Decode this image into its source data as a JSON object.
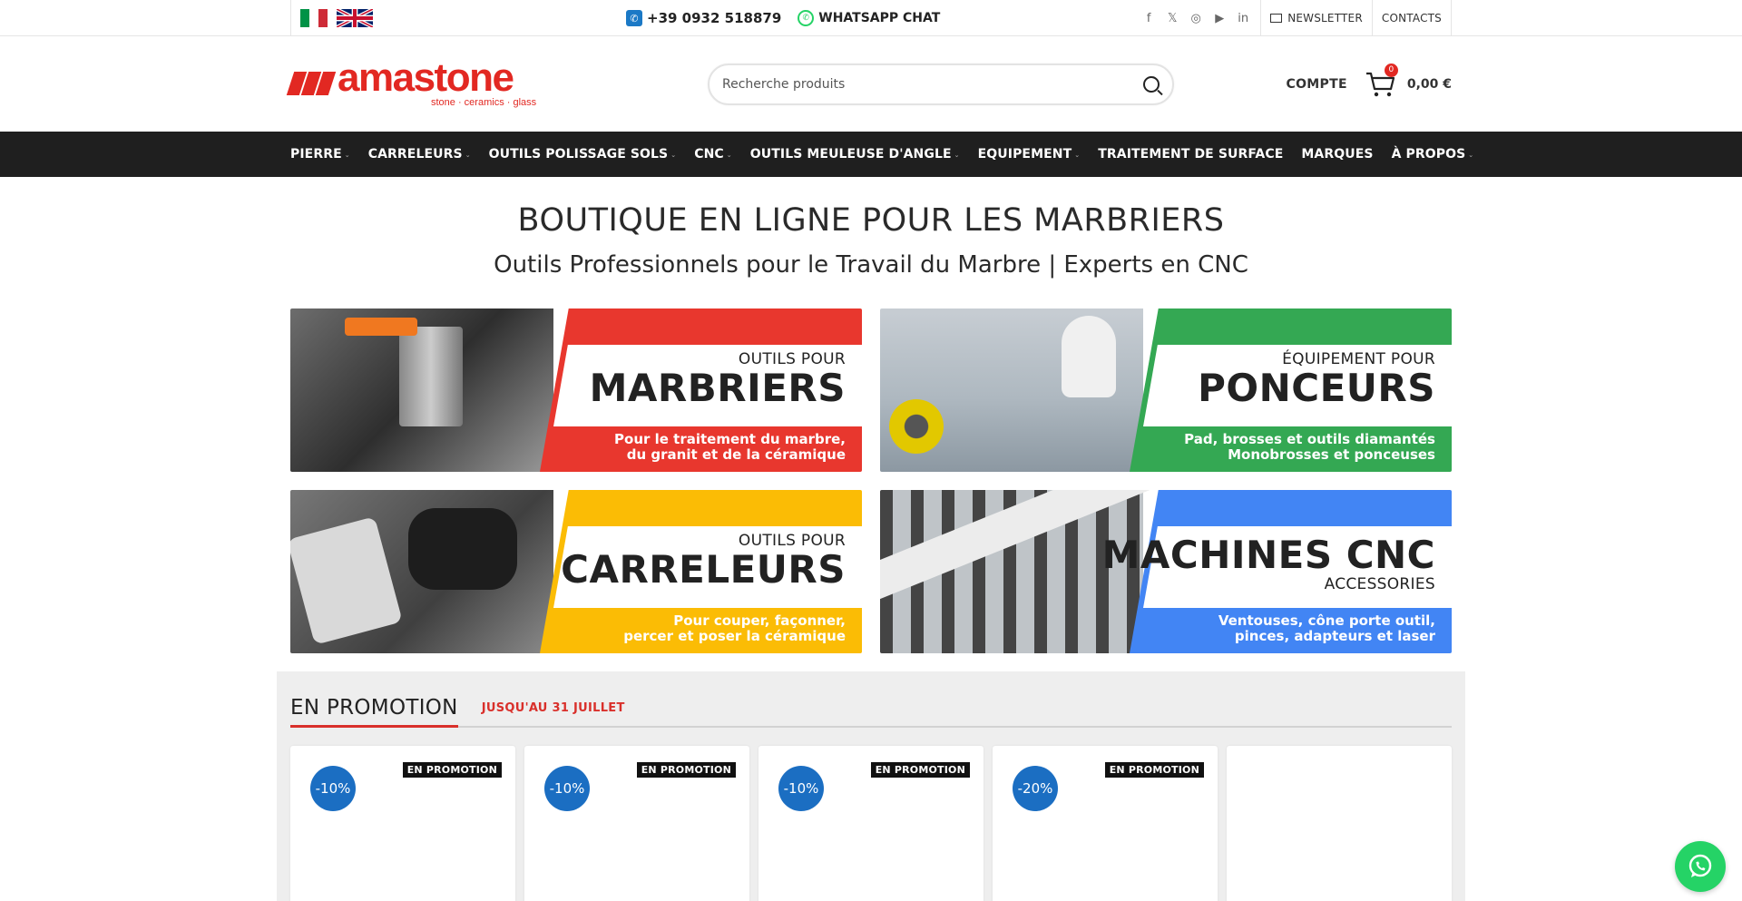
{
  "topbar": {
    "phone": "+39 0932 518879",
    "whatsapp": "WHATSAPP CHAT",
    "newsletter": "NEWSLETTER",
    "contacts": "CONTACTS",
    "socials": [
      "facebook-icon",
      "x-icon",
      "instagram-icon",
      "youtube-icon",
      "linkedin-icon"
    ],
    "flags": [
      "italian-flag",
      "uk-flag"
    ]
  },
  "header": {
    "logo_text": "amastone",
    "logo_sub": "stone · ceramics · glass",
    "search_placeholder": "Recherche produits",
    "account": "COMPTE",
    "cart_count": "0",
    "cart_total": "0,00 €"
  },
  "nav": {
    "items": [
      {
        "label": "PIERRE",
        "has_sub": true
      },
      {
        "label": "CARRELEURS",
        "has_sub": true
      },
      {
        "label": "OUTILS POLISSAGE SOLS",
        "has_sub": true
      },
      {
        "label": "CNC",
        "has_sub": true
      },
      {
        "label": "OUTILS MEULEUSE D'ANGLE",
        "has_sub": true
      },
      {
        "label": "EQUIPEMENT",
        "has_sub": true
      },
      {
        "label": "TRAITEMENT DE SURFACE",
        "has_sub": false
      },
      {
        "label": "MARQUES",
        "has_sub": false
      },
      {
        "label": "À PROPOS",
        "has_sub": true
      }
    ]
  },
  "hero": {
    "title": "BOUTIQUE EN LIGNE POUR LES MARBRIERS",
    "subtitle": "Outils Professionnels pour le Travail du Marbre | Experts en CNC"
  },
  "banners": [
    {
      "small": "OUTILS POUR",
      "big": "MARBRIERS",
      "desc1": "Pour le traitement du marbre,",
      "desc2": "du granit et de la céramique",
      "color": "#e8372e"
    },
    {
      "small": "ÉQUIPEMENT POUR",
      "big": "PONCEURS",
      "desc1": "Pad, brosses et outils diamantés",
      "desc2": "Monobrosses et ponceuses",
      "color": "#34a853"
    },
    {
      "small": "OUTILS POUR",
      "big": "CARRELEURS",
      "desc1": "Pour couper, façonner,",
      "desc2": "percer et poser la céramique",
      "color": "#fbbc05"
    },
    {
      "small": "ACCESSORIES",
      "big": "MACHINES CNC",
      "desc1": "Ventouses, cône porte outil,",
      "desc2": "pinces, adapteurs et laser",
      "color": "#4285f4"
    }
  ],
  "promo": {
    "title": "EN PROMOTION",
    "date": "JUSQU'AU 31 JUILLET",
    "cards": [
      {
        "discount": "-10%",
        "tag": "EN PROMOTION"
      },
      {
        "discount": "-10%",
        "tag": "EN PROMOTION"
      },
      {
        "discount": "-10%",
        "tag": "EN PROMOTION"
      },
      {
        "discount": "-20%",
        "tag": "EN PROMOTION"
      },
      {
        "discount": "",
        "tag": ""
      }
    ]
  }
}
